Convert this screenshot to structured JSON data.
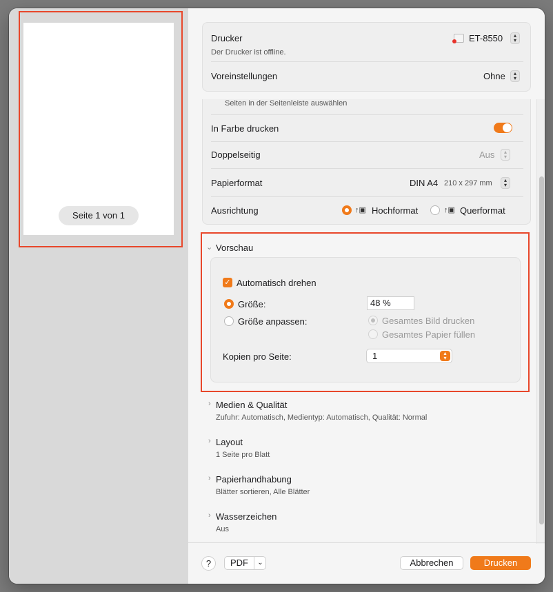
{
  "preview": {
    "page_label": "Seite 1 von 1"
  },
  "printer": {
    "label": "Drucker",
    "value": "ET-8550",
    "status": "Der Drucker ist offline.",
    "presets_label": "Voreinstellungen",
    "presets_value": "Ohne"
  },
  "options": {
    "pages_hint": "Seiten in der Seitenleiste auswählen",
    "color_label": "In Farbe drucken",
    "duplex_label": "Doppelseitig",
    "duplex_value": "Aus",
    "paper_label": "Papierformat",
    "paper_value": "DIN A4",
    "paper_size": "210 x 297 mm",
    "orientation_label": "Ausrichtung",
    "portrait": "Hochformat",
    "landscape": "Querformat"
  },
  "vorschau": {
    "title": "Vorschau",
    "auto_rotate": "Automatisch drehen",
    "size_label": "Größe:",
    "size_value": "48 %",
    "fit_label": "Größe anpassen:",
    "fit_option1": "Gesamtes Bild drucken",
    "fit_option2": "Gesamtes Papier füllen",
    "copies_label": "Kopien pro Seite:",
    "copies_value": "1"
  },
  "sections": [
    {
      "title": "Medien & Qualität",
      "summary": "Zufuhr: Automatisch, Medientyp: Automatisch, Qualität: Normal"
    },
    {
      "title": "Layout",
      "summary": "1 Seite pro Blatt"
    },
    {
      "title": "Papierhandhabung",
      "summary": "Blätter sortieren, Alle Blätter"
    },
    {
      "title": "Wasserzeichen",
      "summary": "Aus"
    }
  ],
  "footer": {
    "help": "?",
    "pdf": "PDF",
    "cancel": "Abbrechen",
    "print": "Drucken"
  },
  "colors": {
    "accent": "#f07a1a",
    "highlight": "#e8472b"
  }
}
